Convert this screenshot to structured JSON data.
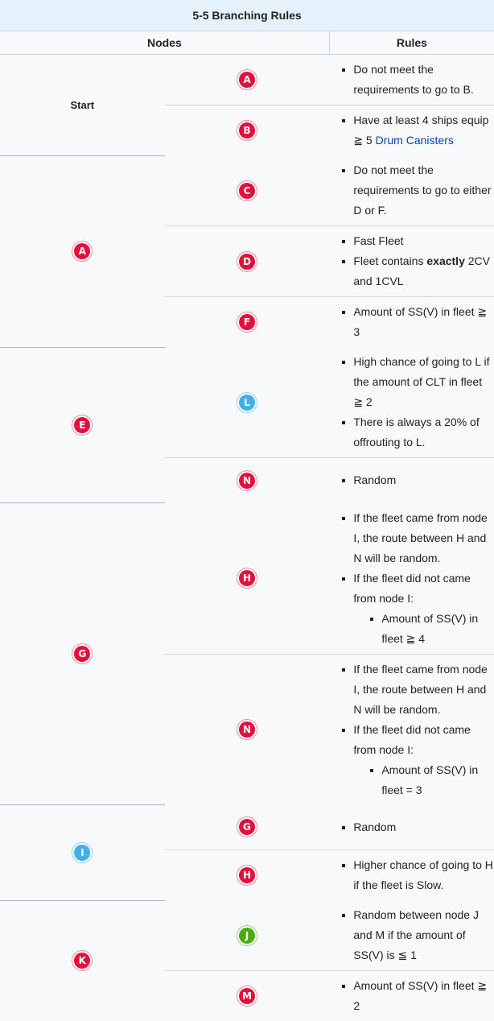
{
  "title": "5-5 Branching Rules",
  "headers": {
    "nodes": "Nodes",
    "rules": "Rules"
  },
  "rows": {
    "start": {
      "label": "Start",
      "a": {
        "badge": "A",
        "rule1": "Do not meet the requirements to go to B."
      },
      "b": {
        "badge": "B",
        "rule1_pre": "Have at least 4 ships equip ≧ 5 ",
        "rule1_link": "Drum Canisters"
      }
    },
    "a": {
      "badge": "A",
      "c": {
        "badge": "C",
        "rule1": "Do not meet the requirements to go to either D or F."
      },
      "d": {
        "badge": "D",
        "rule1": "Fast Fleet",
        "rule2_pre": "Fleet contains ",
        "rule2_bold": "exactly",
        "rule2_post": " 2CV and 1CVL"
      },
      "f": {
        "badge": "F",
        "rule1": "Amount of SS(V) in fleet ≧ 3"
      }
    },
    "e": {
      "badge": "E",
      "l": {
        "badge": "L",
        "rule1": "High chance of going to L if the amount of CLT in fleet ≧ 2",
        "rule2": "There is always a 20% of offrouting to L."
      },
      "n": {
        "badge": "N",
        "rule1": "Random"
      }
    },
    "g": {
      "badge": "G",
      "h": {
        "badge": "H",
        "rule1": "If the fleet came from node I, the route between H and N will be random.",
        "rule2": "If the fleet did not came from node I:",
        "rule2a": "Amount of SS(V) in fleet ≧ 4"
      },
      "n": {
        "badge": "N",
        "rule1": "If the fleet came from node I, the route between H and N will be random.",
        "rule2": "If the fleet did not came from node I:",
        "rule2a": "Amount of SS(V) in fleet = 3"
      }
    },
    "i": {
      "badge": "I",
      "g": {
        "badge": "G",
        "rule1": "Random"
      },
      "h": {
        "badge": "H",
        "rule1": "Higher chance of going to H if the fleet is Slow."
      }
    },
    "k": {
      "badge": "K",
      "j": {
        "badge": "J",
        "rule1": "Random between node J and M if the amount of SS(V) is ≦ 1"
      },
      "m": {
        "badge": "M",
        "rule1": "Amount of SS(V) in fleet ≧ 2"
      }
    }
  },
  "colors": {
    "red": "#e4103c",
    "blue": "#3fb0ec",
    "green": "#4caa12",
    "link": "#0645ad",
    "title_bg": "#e6f2fb"
  }
}
